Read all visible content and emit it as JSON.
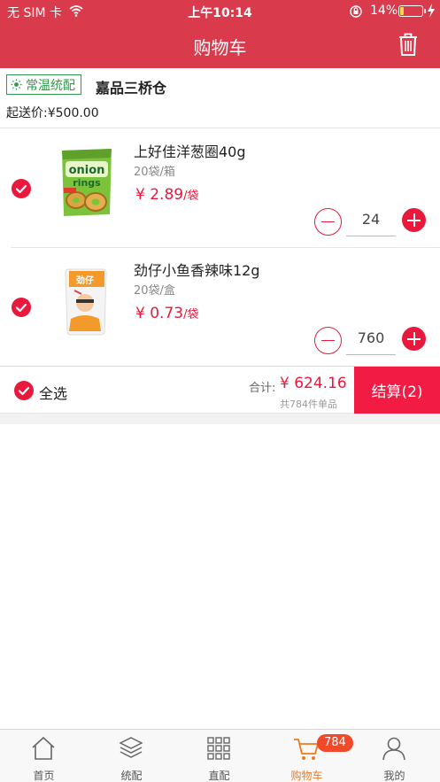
{
  "status_bar": {
    "carrier": "无 SIM 卡",
    "time": "上午10:14",
    "battery_pct": "14%",
    "battery_level": 0.14
  },
  "nav": {
    "title": "购物车",
    "icon": "trash-icon"
  },
  "store": {
    "badge": "常温统配",
    "badge_icon": "sun-icon",
    "name": "嘉品三桥仓",
    "min_order": "起送价:¥500.00"
  },
  "items": [
    {
      "title": "上好佳洋葱圈40g",
      "spec": "20袋/箱",
      "price": "¥ 2.89",
      "unit": "/袋",
      "qty": "24",
      "checked": true
    },
    {
      "title": "劲仔小鱼香辣味12g",
      "spec": "20袋/盒",
      "price": "¥ 0.73",
      "unit": "/袋",
      "qty": "760",
      "checked": true
    }
  ],
  "summary": {
    "select_all": "全选",
    "total_label": "合计:",
    "total_value": "¥ 624.16",
    "count": "共784件单品",
    "checkout": "结算(2)"
  },
  "tabs": [
    {
      "label": "首页",
      "icon": "home-icon"
    },
    {
      "label": "统配",
      "icon": "layers-icon"
    },
    {
      "label": "直配",
      "icon": "grid-icon"
    },
    {
      "label": "购物车",
      "icon": "cart-icon",
      "badge": "784",
      "active": true
    },
    {
      "label": "我的",
      "icon": "user-icon"
    }
  ],
  "colors": {
    "header": "#d93a4c",
    "accent": "#e8193c",
    "checkout": "#f21b44",
    "badge_green": "#2f9a4c",
    "tab_active": "#ee7a1b"
  }
}
